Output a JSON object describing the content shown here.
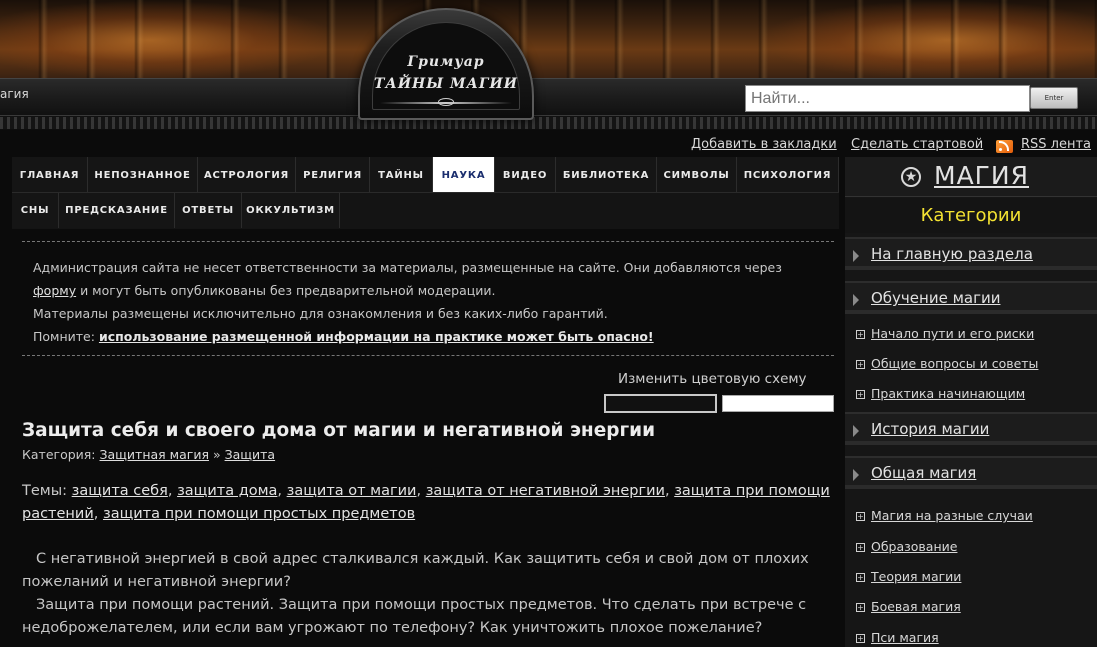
{
  "header": {
    "logo_line1": "Гримуар",
    "logo_line2": "ТАЙНЫ МАГИИ",
    "left_text": "агия",
    "search_placeholder": "Найти...",
    "search_button": "Enter"
  },
  "top_links": {
    "bookmark": "Добавить в закладки",
    "homepage": "Сделать стартовой",
    "rss": "RSS лента"
  },
  "nav": {
    "row1": [
      "ГЛАВНАЯ",
      "НЕПОЗНАННОЕ",
      "АСТРОЛОГИЯ",
      "РЕЛИГИЯ",
      "ТАЙНЫ",
      "НАУКА",
      "ВИДЕО",
      "БИБЛИОТЕКА",
      "СИМВОЛЫ",
      "ПСИХОЛОГИЯ"
    ],
    "row2": [
      "СНЫ",
      "ПРЕДСКАЗАНИЕ",
      "ОТВЕТЫ",
      "ОККУЛЬТИЗМ"
    ],
    "active": "НАУКА"
  },
  "notice": {
    "line1": "Администрация сайта не несет ответственности за материалы, размещенные на сайте. Они добавляются через",
    "form_link": "форму",
    "line2_rest": " и могут быть опубликованы без предварительной модерации.",
    "line3": "Материалы размещены исключительно для ознакомления и без каких-либо гарантий.",
    "line4_prefix": "Помните: ",
    "warning": "использование размещенной информации на практике может быть опасно!"
  },
  "color_scheme": {
    "label": "Изменить цветовую схему"
  },
  "article": {
    "title": "Защита себя и своего дома от магии и негативной энергии",
    "category_label": "Категория: ",
    "category": "Защитная магия",
    "category_sep": " » ",
    "subcategory": "Защита",
    "themes_label": "Темы: ",
    "themes": [
      "защита себя",
      "защита дома",
      "защита от магии",
      "защита от негативной энергии",
      "защита при помощи растений",
      "защита при помощи простых предметов"
    ],
    "paragraph1": "С негативной энергией в свой адрес сталкивался каждый. Как защитить себя и свой дом от плохих пожеланий и негативной энергии?",
    "paragraph2": "Защита при помощи растений. Защита при помощи простых предметов. Что сделать при встрече с недоброжелателем, или если вам угрожают по телефону? Как уничтожить плохое пожелание?"
  },
  "sidebar": {
    "title": "МАГИЯ",
    "subtitle": "Категории",
    "home": "На главную раздела",
    "sections": [
      {
        "label": "Обучение магии",
        "items": [
          "Начало пути и его риски",
          "Общие вопросы и советы",
          "Практика начинающим"
        ]
      },
      {
        "label": "История магии",
        "items": []
      },
      {
        "label": "Общая магия",
        "items": [
          "Магия на разные случаи",
          "Образование",
          "Теория магии",
          "Боевая магия",
          "Пси магия"
        ]
      }
    ],
    "accent_color": "#f3e232"
  }
}
